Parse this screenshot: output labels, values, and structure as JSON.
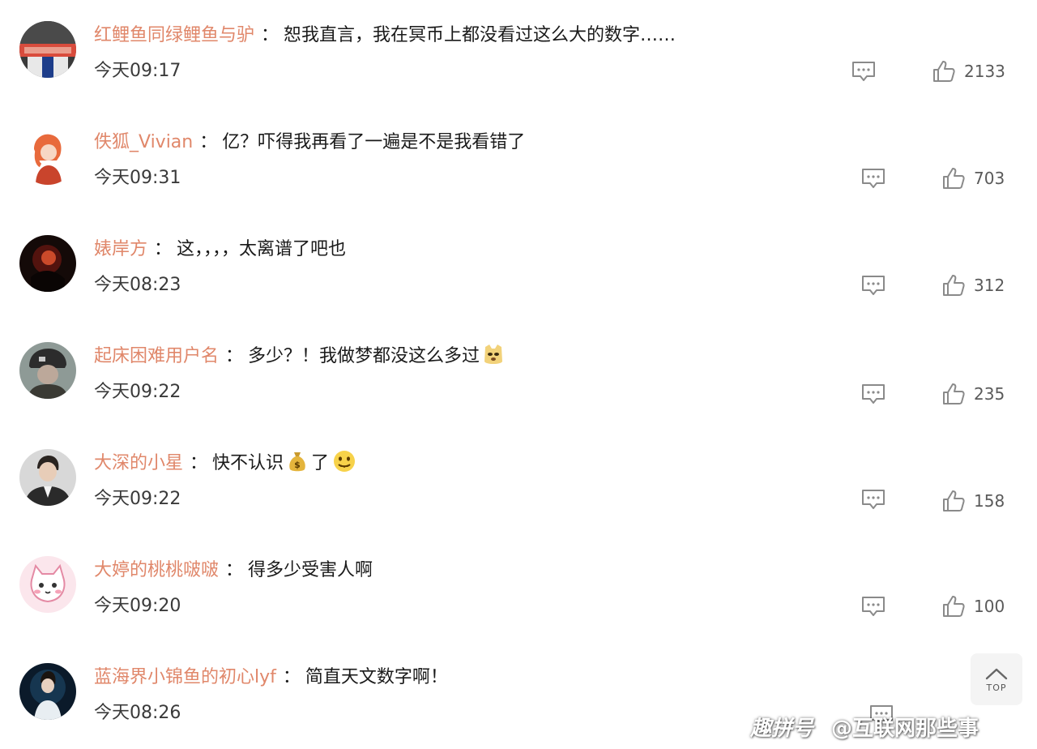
{
  "comments": [
    {
      "username": "红鲤鱼同绿鲤鱼与驴",
      "separator": "：",
      "text": "恕我直言，我在冥币上都没看过这么大的数字……",
      "time": "今天09:17",
      "likes": "2133",
      "avatar_icon": "badge-avatar-icon"
    },
    {
      "username": "佚狐_Vivian",
      "separator": "：",
      "text": "亿？吓得我再看了一遍是不是我看错了",
      "time": "今天09:31",
      "likes": "703",
      "avatar_icon": "red-hair-girl-avatar-icon"
    },
    {
      "username": "婊岸方",
      "separator": "：",
      "text": "这，，，，太离谱了吧也",
      "time": "今天08:23",
      "likes": "312",
      "avatar_icon": "dark-silhouette-avatar-icon"
    },
    {
      "username": "起床困难用户名",
      "separator": "：",
      "text": "多少？！我做梦都没这么多过",
      "time": "今天09:22",
      "likes": "235",
      "avatar_icon": "soldier-avatar-icon",
      "emoji": "doge-emoji-icon"
    },
    {
      "username": "大深的小星",
      "separator": "：",
      "text_before": "快不认识",
      "text_after": "了",
      "time": "今天09:22",
      "likes": "158",
      "avatar_icon": "man-in-suit-avatar-icon",
      "emoji_money": "money-bag-emoji-icon",
      "emoji_face": "zipped-mouth-emoji-icon"
    },
    {
      "username": "大婷的桃桃啵啵",
      "separator": "：",
      "text": "得多少受害人啊",
      "time": "今天09:20",
      "likes": "100",
      "avatar_icon": "pink-cat-avatar-icon"
    },
    {
      "username": "蓝海界小锦鱼的初心lyf",
      "separator": "：",
      "text": "简直天文数字啊！",
      "time": "今天08:26",
      "likes": "",
      "avatar_icon": "singer-avatar-icon"
    }
  ],
  "top_button": {
    "label": "TOP"
  },
  "watermark": {
    "brand": "趣拼号",
    "account": "@互联网那些事"
  },
  "colors": {
    "username": "#e0876a",
    "text": "#1a1a1a",
    "icon_gray": "#8a8a8a"
  }
}
